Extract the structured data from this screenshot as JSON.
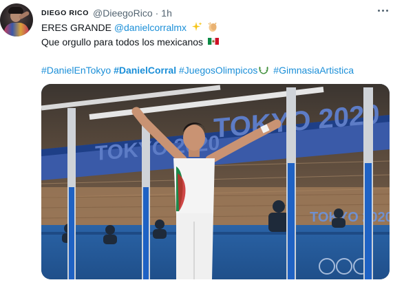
{
  "tweet": {
    "author_name": "DIEGO RICO",
    "author_handle": "@DieegoRico",
    "separator": "·",
    "timestamp": "1h",
    "text_line1": "ERES GRANDE",
    "mention": "@danielcorralmx",
    "text_line2": "Que orgullo para todos los mexicanos",
    "hashtags": [
      "#DanielEnTokyo",
      "#DanielCorral",
      "#JuegosOlimpicos",
      "#GimnasiaArtistica"
    ],
    "emojis": [
      "sparkles",
      "clapping-hands",
      "flag-mexico",
      "laurel-wreath"
    ]
  },
  "media": {
    "description_icons": [
      "parallel-bars",
      "gymnast"
    ],
    "backdrop_text": [
      "TOKYO 2020",
      "TOKYO 2020",
      "TOKYO 2020"
    ]
  },
  "colors": {
    "link": "#1b8fd8",
    "secondary_text": "#536471",
    "primary_text": "#0f1419"
  }
}
